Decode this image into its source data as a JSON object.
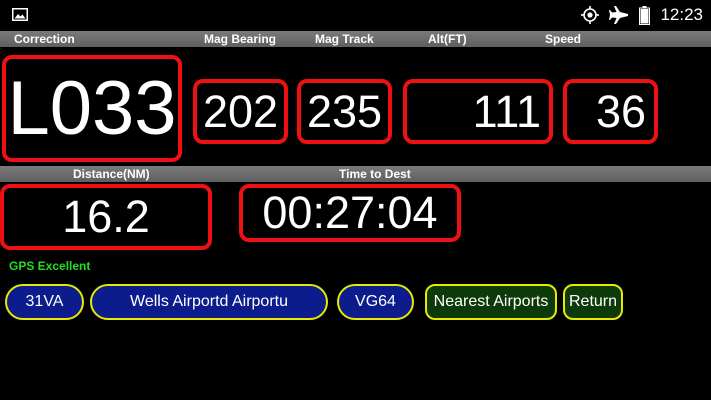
{
  "status_bar": {
    "time": "12:23",
    "icons": [
      "gallery-icon",
      "gps-icon",
      "airplane-mode-icon",
      "battery-icon"
    ]
  },
  "headers_top": {
    "correction": "Correction",
    "mag_bearing": "Mag Bearing",
    "mag_track": "Mag Track",
    "alt": "Alt(FT)",
    "speed": "Speed"
  },
  "values_top": {
    "correction": "L033",
    "mag_bearing": "202",
    "mag_track": "235",
    "alt": "111",
    "speed": "36"
  },
  "headers_mid": {
    "distance": "Distance(NM)",
    "time_to_dest": "Time to Dest"
  },
  "values_mid": {
    "distance": "16.2",
    "time_to_dest": "00:27:04"
  },
  "gps_status": "GPS Excellent",
  "buttons": {
    "origin": "31VA",
    "name": "Wells Airportd Airportu",
    "dest": "VG64",
    "nearest": "Nearest Airports",
    "return": "Return"
  },
  "colors": {
    "box_border": "#ee1111",
    "pill_border": "#e8e800",
    "pill_blue": "#0c1c8c",
    "pill_green": "#0c3a08",
    "gps_text": "#22dd22"
  }
}
